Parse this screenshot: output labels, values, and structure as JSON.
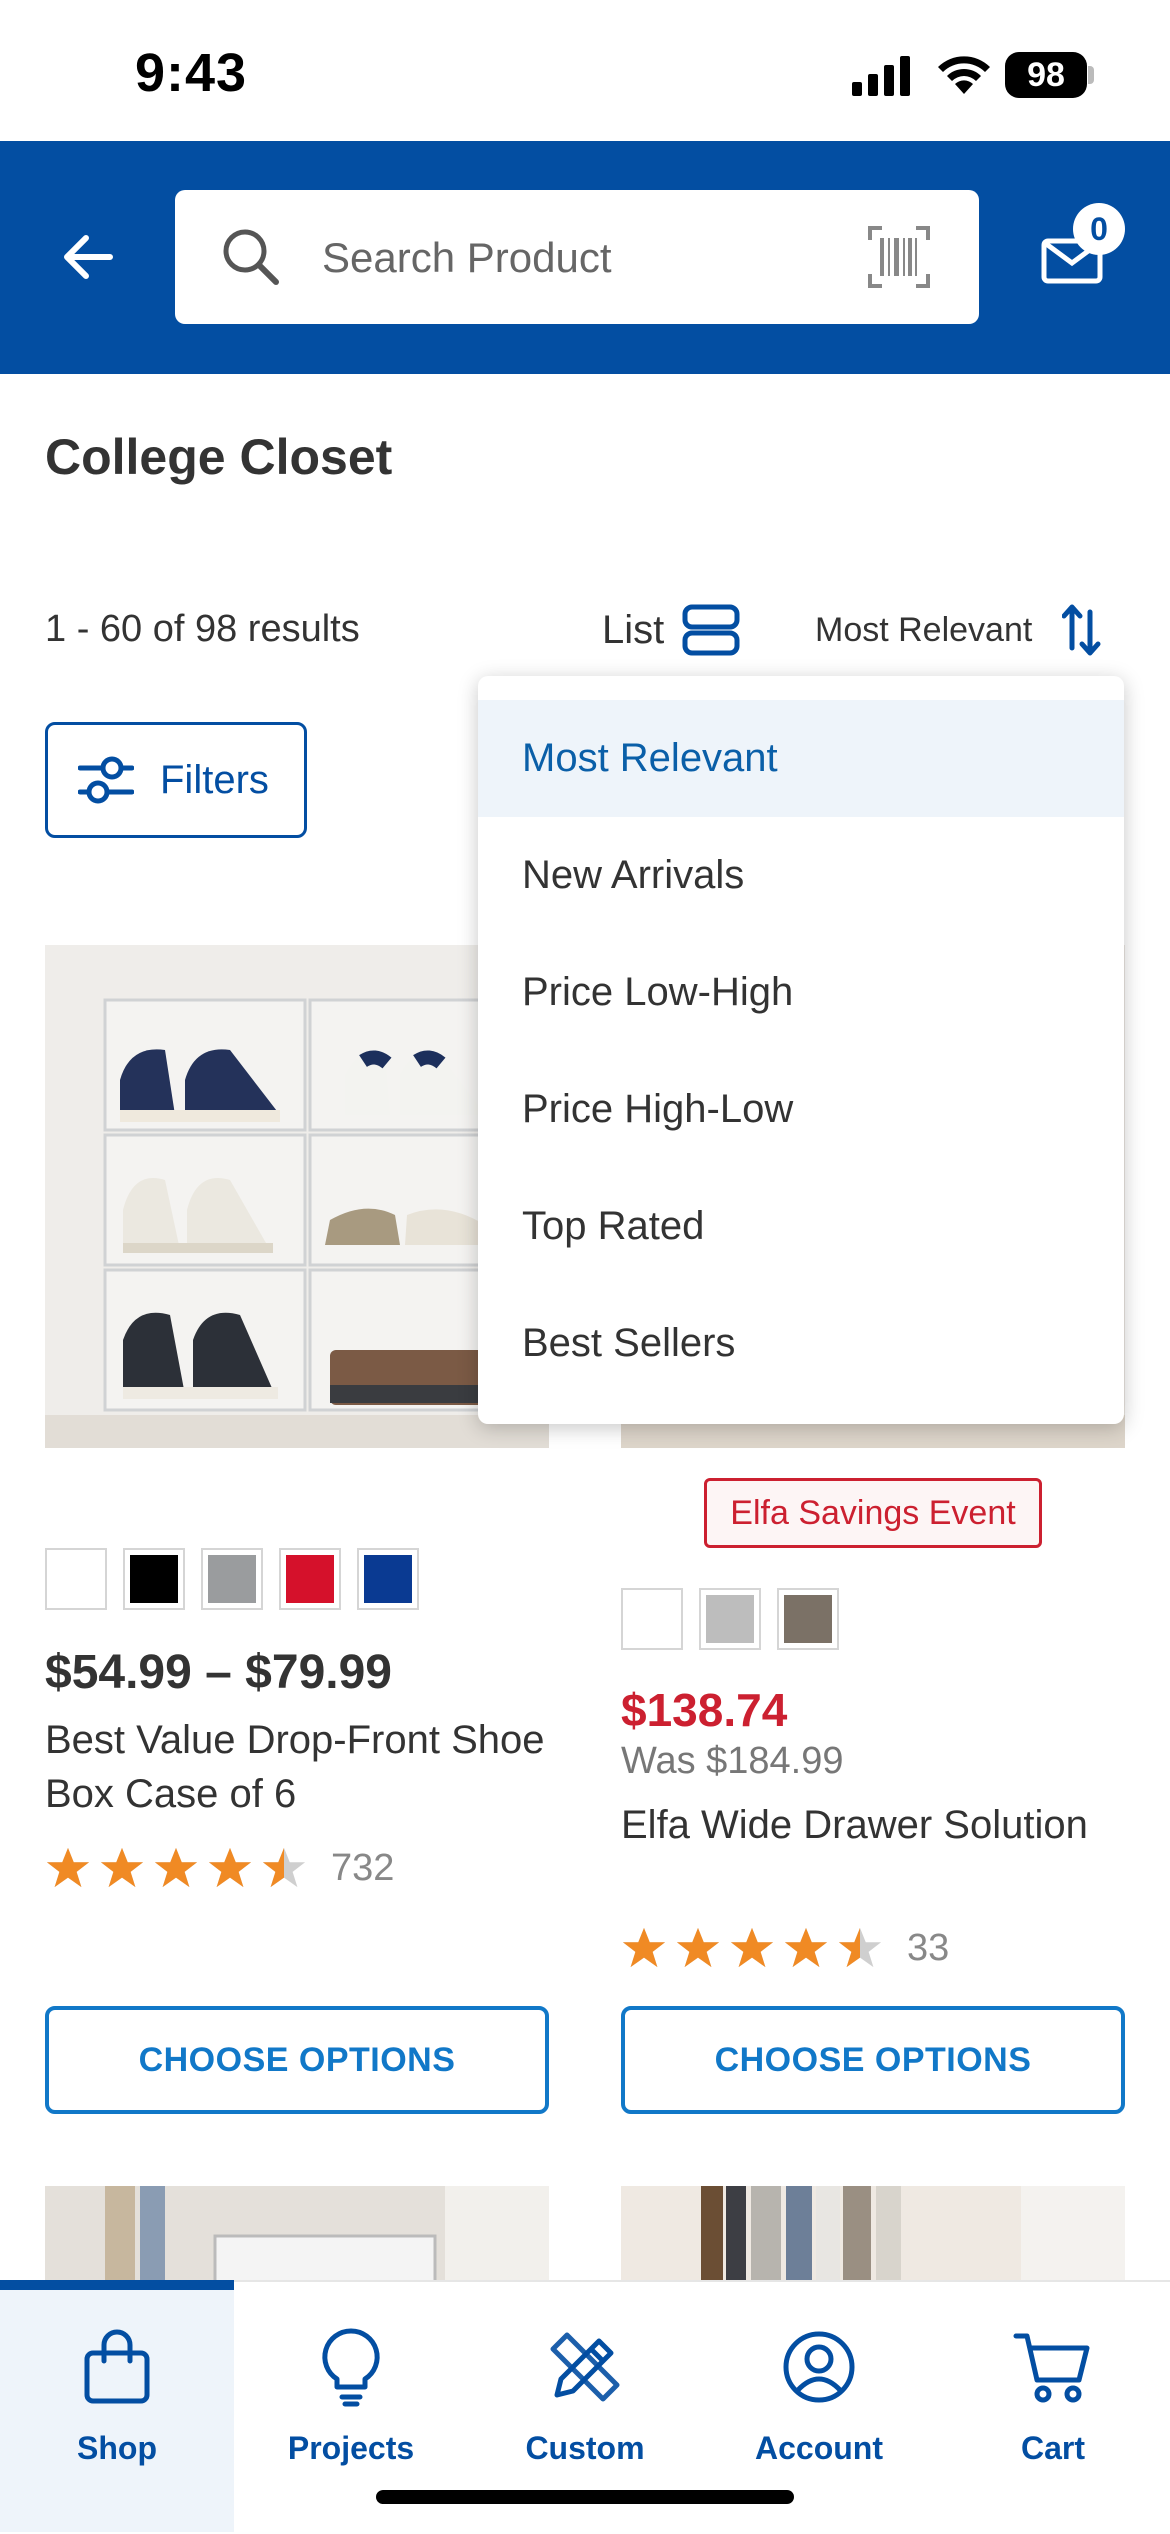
{
  "status_bar": {
    "time": "9:43",
    "battery": "98"
  },
  "header": {
    "search_placeholder": "Search Product",
    "mail_badge": "0",
    "colors": {
      "brand": "#034ea2"
    }
  },
  "page": {
    "title": "College Closet",
    "results_count": "1 - 60 of 98 results",
    "view_label": "List",
    "sort_label": "Most Relevant",
    "filters_label": "Filters"
  },
  "sort_menu": {
    "items": [
      {
        "label": "Most Relevant",
        "selected": true
      },
      {
        "label": "New Arrivals"
      },
      {
        "label": "Price Low-High"
      },
      {
        "label": "Price High-Low"
      },
      {
        "label": "Top Rated"
      },
      {
        "label": "Best Sellers"
      }
    ]
  },
  "products": [
    {
      "swatches": [
        "#ffffff",
        "#000000",
        "#9a9c9e",
        "#d5112b",
        "#0a3a92"
      ],
      "price": "$54.99 – $79.99",
      "name": "Best Value Drop-Front Shoe Box Case of 6",
      "rating": 4.5,
      "rating_count": "732",
      "button_label": "CHOOSE OPTIONS"
    },
    {
      "badge": "Elfa Savings Event",
      "swatches": [
        "#ffffff",
        "#bdbdbd",
        "#7b7166"
      ],
      "price": "$138.74",
      "was_price": "Was $184.99",
      "name": "Elfa Wide Drawer Solution",
      "rating": 4.5,
      "rating_count": "33",
      "button_label": "CHOOSE OPTIONS"
    }
  ],
  "tab_bar": {
    "tabs": [
      {
        "label": "Shop",
        "icon": "shopping-bag-icon",
        "active": true
      },
      {
        "label": "Projects",
        "icon": "lightbulb-icon"
      },
      {
        "label": "Custom",
        "icon": "pencil-ruler-icon"
      },
      {
        "label": "Account",
        "icon": "user-circle-icon"
      },
      {
        "label": "Cart",
        "icon": "cart-icon"
      }
    ]
  }
}
